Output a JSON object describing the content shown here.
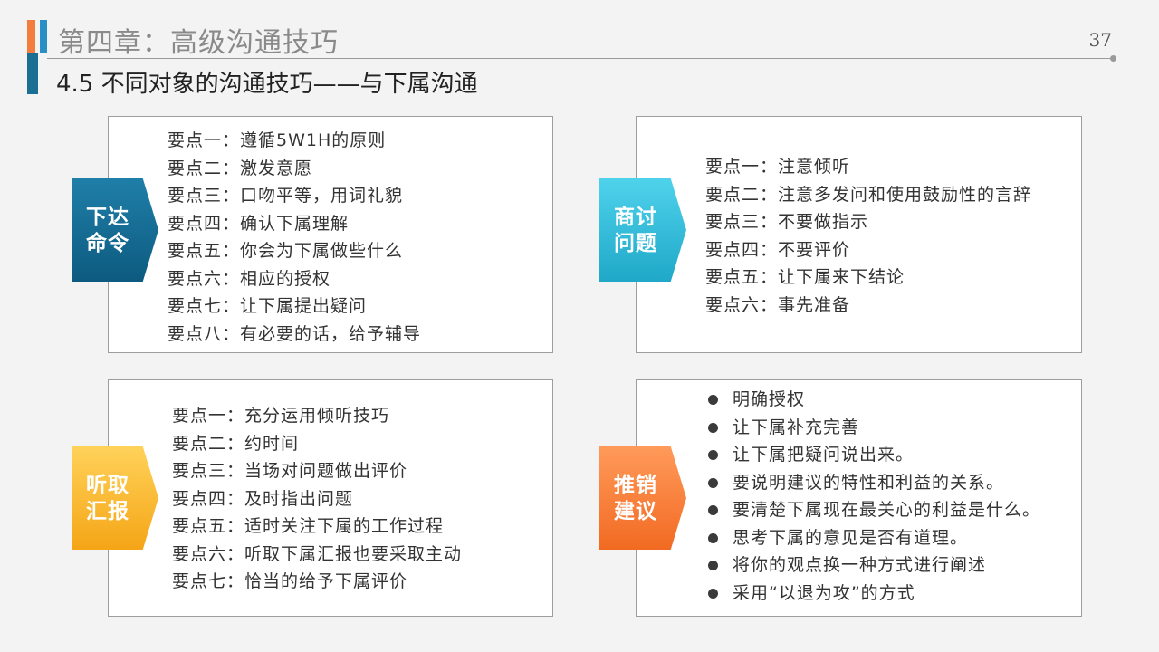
{
  "header": {
    "chapter_title": "第四章：高级沟通技巧",
    "page_number": "37",
    "section_title": "4.5 不同对象的沟通技巧——与下属沟通"
  },
  "panels": [
    {
      "tag": "下达命令",
      "color": "#0d5a80",
      "items": [
        "要点一：遵循5W1H的原则",
        "要点二：激发意愿",
        "要点三：口吻平等，用词礼貌",
        "要点四：确认下属理解",
        "要点五：你会为下属做些什么",
        "要点六：相应的授权",
        "要点七：让下属提出疑问",
        "要点八：有必要的话，给予辅导"
      ]
    },
    {
      "tag": "商讨问题",
      "color": "#1fa8c8",
      "items": [
        "要点一：注意倾听",
        "要点二：注意多发问和使用鼓励性的言辞",
        "要点三：不要做指示",
        "要点四：不要评价",
        "要点五：让下属来下结论",
        "要点六：事先准备"
      ]
    },
    {
      "tag": "听取汇报",
      "color": "#f5a516",
      "items": [
        "要点一：充分运用倾听技巧",
        "要点二：约时间",
        "要点三：当场对问题做出评价",
        "要点四：及时指出问题",
        "要点五：适时关注下属的工作过程",
        "要点六：听取下属汇报也要采取主动",
        "要点七：恰当的给予下属评价"
      ]
    },
    {
      "tag": "推销建议",
      "color": "#f26a22",
      "items": [
        "明确授权",
        "让下属补充完善",
        "让下属把疑问说出来。",
        "要说明建议的特性和利益的关系。",
        "要清楚下属现在最关心的利益是什么。",
        "思考下属的意见是否有道理。",
        "将你的观点换一种方式进行阐述",
        "采用“以退为攻”的方式"
      ]
    }
  ]
}
